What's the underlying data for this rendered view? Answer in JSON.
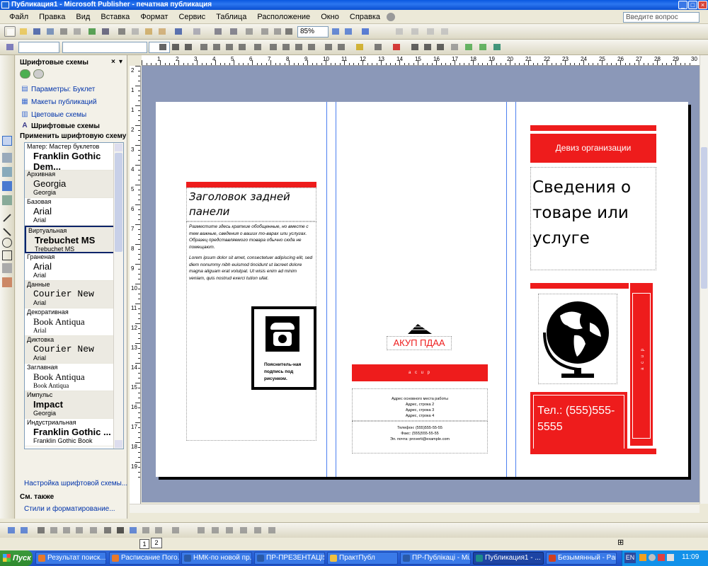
{
  "window": {
    "title": "Публикация1 - Microsoft Publisher - печатная публикация",
    "btn_min": "_",
    "btn_max": "□",
    "btn_close": "×"
  },
  "menu": {
    "items": [
      "Файл",
      "Правка",
      "Вид",
      "Вставка",
      "Формат",
      "Сервис",
      "Таблица",
      "Расположение",
      "Окно",
      "Справка"
    ],
    "ask_placeholder": "Введите вопрос"
  },
  "toolbar": {
    "zoom": "85%",
    "font_size": "",
    "font_name": ""
  },
  "taskpane": {
    "title": "Шрифтовые схемы",
    "links": [
      {
        "label": "Параметры: Буклет",
        "icon": "booklet-icon"
      },
      {
        "label": "Макеты публикаций",
        "icon": "layout-icon"
      },
      {
        "label": "Цветовые схемы",
        "icon": "color-scheme-icon"
      },
      {
        "label": "Шрифтовые схемы",
        "icon": "font-scheme-icon"
      }
    ],
    "apply_label": "Применить шрифтовую схему",
    "font_schemes": [
      {
        "name": "Матер: Мастер буклетов",
        "major": "Franklin Gothic Dem...",
        "minor": "Franklin Gothic Book",
        "major_bold": true
      },
      {
        "name": "Архивная",
        "major": "Georgia",
        "minor": "Georgia",
        "major_bold": false
      },
      {
        "name": "Базовая",
        "major": "Arial",
        "minor": "Arial",
        "major_bold": false
      },
      {
        "name": "Виртуальная",
        "major": "Trebuchet MS",
        "minor": "Trebuchet MS",
        "major_bold": true,
        "selected": true
      },
      {
        "name": "Граненая",
        "major": "Arial",
        "minor": "Arial",
        "major_bold": false
      },
      {
        "name": "Данные",
        "major": "Courier New",
        "minor": "Arial",
        "major_bold": false,
        "mono": true
      },
      {
        "name": "Декоративная",
        "major": "Book Antiqua",
        "minor": "Arial",
        "major_bold": false,
        "serif": true
      },
      {
        "name": "Диктовка",
        "major": "Courier New",
        "minor": "Arial",
        "major_bold": false,
        "mono": true
      },
      {
        "name": "Заглавная",
        "major": "Book Antiqua",
        "minor": "Book Antiqua",
        "major_bold": false,
        "serif": true
      },
      {
        "name": "Импульс",
        "major": "Impact",
        "minor": "Georgia",
        "major_bold": true
      },
      {
        "name": "Индустриальная",
        "major": "Franklin Gothic ...",
        "minor": "Franklin Gothic Book",
        "major_bold": true
      }
    ],
    "setup_link": "Настройка шрифтовой схемы...",
    "see_also": "См. также",
    "styles_link": "Стили и форматирование..."
  },
  "ruler": {
    "h_marks": [
      "1",
      "2",
      "3",
      "4",
      "5",
      "6",
      "7",
      "8",
      "9",
      "10",
      "11",
      "12",
      "13",
      "14",
      "15",
      "16",
      "17",
      "18",
      "19",
      "20",
      "21",
      "22",
      "23",
      "24",
      "25",
      "26",
      "27",
      "28",
      "29",
      "30"
    ],
    "v_marks": [
      "2",
      "1",
      "1",
      "2",
      "3",
      "4",
      "5",
      "6",
      "7",
      "8",
      "9",
      "10",
      "11",
      "12",
      "13",
      "14",
      "15",
      "16",
      "17",
      "18",
      "19"
    ]
  },
  "brochure": {
    "back_title": "Заголовок задней панели",
    "back_text1": "Разместите здесь краткие обобщенные, но вместе с тем важные, сведения о ваших то-варах или услугах. Образец представляемого товара обычно сюда не помещают.",
    "back_text2": "Lorem ipsum dolor sit amet, consectetuer adipiscing elit, sed diem nonummy nibh euismod tincidunt ut lacreet dolore magna aliguam erat volutpat. Ut wisis enim ad minim veniam, quis nostrud exerci tution ullat.",
    "caption": "Пояснитель-ная подпись под рисунком.",
    "logo_text": "АКУП ПДАА",
    "red_band_text": "а с u р",
    "address": [
      "Адрес основного места работы",
      "Адрес, строка 2",
      "Адрес, строка 3",
      "Адрес, строка 4"
    ],
    "contacts": [
      "Телефон: (555)555-55-55",
      "Факс: (555)555-55-55",
      "Эл. почта: proverti@example.com"
    ],
    "motto": "Девиз организации",
    "front_title": "Сведения о товаре или услуге",
    "side_vertical": "а с u р",
    "phone_big": "Тел.: (555)555-5555"
  },
  "pages": [
    "1",
    "2"
  ],
  "taskbar": {
    "start": "Пуск",
    "tasks": [
      {
        "label": "Результат поиск...",
        "icon_color": "#e8792a"
      },
      {
        "label": "Расписание Пого...",
        "icon_color": "#e8792a"
      },
      {
        "label": "НМК-по новой пр...",
        "icon_color": "#2a5aa8"
      },
      {
        "label": "ПР-ПРЕЗЕНТАЦІЯ...",
        "icon_color": "#2a5aa8"
      },
      {
        "label": "ПрактПубл",
        "icon_color": "#f0c040"
      },
      {
        "label": "ПР-Публікаці - Mi...",
        "icon_color": "#2a5aa8"
      },
      {
        "label": "Публикация1 - ...",
        "icon_color": "#1d8a8a",
        "active": true
      },
      {
        "label": "Безымянный - Paint",
        "icon_color": "#d04020"
      }
    ],
    "lang": "EN",
    "clock": "11:09"
  }
}
